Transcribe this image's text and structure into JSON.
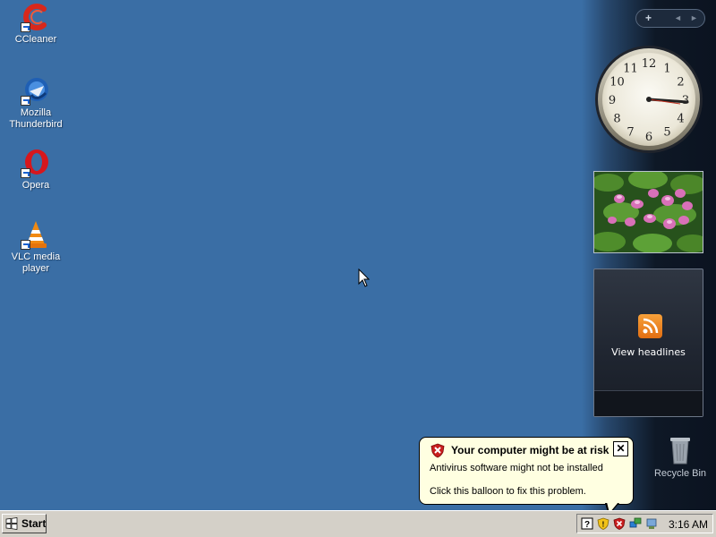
{
  "desktop": {
    "icons": [
      {
        "label": "CCleaner"
      },
      {
        "label": "Mozilla Thunderbird"
      },
      {
        "label": "Opera"
      },
      {
        "label": "VLC media player"
      },
      {
        "label": "Recycle Bin"
      }
    ]
  },
  "sidebar": {
    "controls": {
      "add": "+",
      "prev": "◄",
      "next": "►"
    },
    "clock": {
      "numbers": [
        "12",
        "1",
        "2",
        "3",
        "4",
        "5",
        "6",
        "7",
        "8",
        "9",
        "10",
        "11"
      ],
      "time": "3:16"
    },
    "feed": {
      "label": "View headlines"
    }
  },
  "balloon": {
    "title": "Your computer might be at risk",
    "line1": "Antivirus software might not be installed",
    "line2": "Click this balloon to fix this problem.",
    "close": "✕"
  },
  "taskbar": {
    "start_label": "Start",
    "time": "3:16 AM"
  },
  "colors": {
    "desktop": "#3a6ea5",
    "taskbar": "#d4d0c8",
    "balloon": "#ffffe1"
  }
}
